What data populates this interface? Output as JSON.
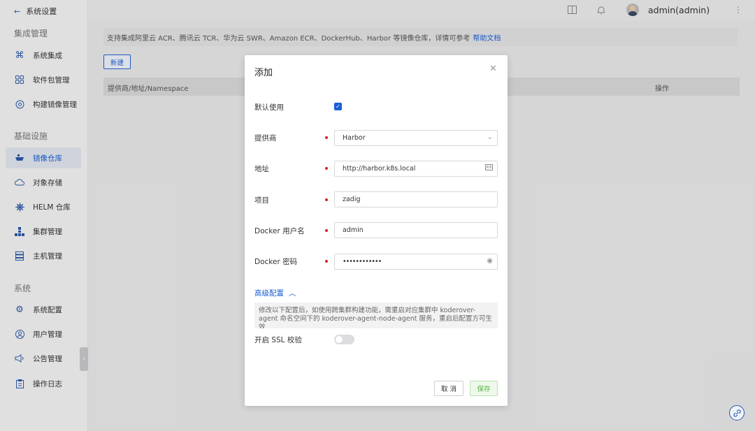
{
  "sidebar": {
    "back_label": "系统设置",
    "sections": [
      {
        "title": "集成管理",
        "items": [
          {
            "label": "系统集成",
            "icon": "command-icon"
          },
          {
            "label": "软件包管理",
            "icon": "grid-icon"
          },
          {
            "label": "构建镜像管理",
            "icon": "disc-icon"
          }
        ]
      },
      {
        "title": "基础设施",
        "items": [
          {
            "label": "镜像仓库",
            "icon": "boat-icon",
            "active": true
          },
          {
            "label": "对象存储",
            "icon": "cloud-icon"
          },
          {
            "label": "HELM 仓库",
            "icon": "helm-icon"
          },
          {
            "label": "集群管理",
            "icon": "cluster-icon"
          },
          {
            "label": "主机管理",
            "icon": "server-icon"
          }
        ]
      },
      {
        "title": "系统",
        "items": [
          {
            "label": "系统配置",
            "icon": "gear-icon"
          },
          {
            "label": "用户管理",
            "icon": "user-icon"
          },
          {
            "label": "公告管理",
            "icon": "megaphone-icon"
          },
          {
            "label": "操作日志",
            "icon": "clipboard-icon"
          }
        ]
      }
    ]
  },
  "header": {
    "username": "admin(admin)"
  },
  "content": {
    "notice_text": "支持集成阿里云 ACR、腾讯云 TCR、华为云 SWR、Amazon ECR、DockerHub、Harbor 等镜像仓库，详情可参考",
    "notice_link": "帮助文档",
    "new_button": "新建",
    "table_columns": [
      "提供商/地址/Namespace",
      "操作"
    ]
  },
  "dialog": {
    "title": "添加",
    "default_use_label": "默认使用",
    "default_use_checked": true,
    "fields": {
      "provider": {
        "label": "提供商",
        "value": "Harbor"
      },
      "address": {
        "label": "地址",
        "value": "http://harbor.k8s.local"
      },
      "project": {
        "label": "项目",
        "value": "zadig"
      },
      "username": {
        "label": "Docker 用户名",
        "value": "admin"
      },
      "password": {
        "label": "Docker 密码",
        "value": "••••••••••••"
      }
    },
    "advanced_label": "高级配置",
    "advanced_note": "修改以下配置后，如使用跨集群构建功能，需重启对应集群中 koderover-agent 命名空间下的 koderover-agent-node-agent 服务，重启后配置方可生效",
    "ssl_label": "开启 SSL 校验",
    "ssl_enabled": false,
    "cancel_button": "取 消",
    "save_button": "保存"
  }
}
